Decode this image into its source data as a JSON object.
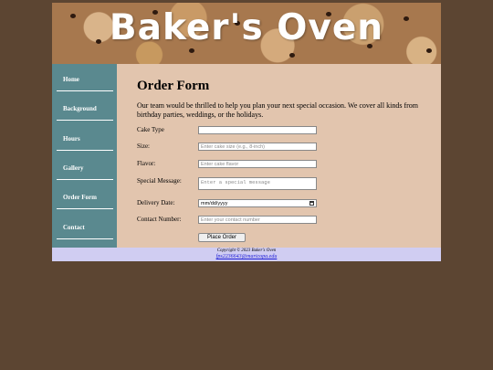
{
  "header": {
    "title": "Baker's Oven"
  },
  "sidebar": {
    "items": [
      {
        "label": "Home"
      },
      {
        "label": "Background"
      },
      {
        "label": "Hours"
      },
      {
        "label": "Gallery"
      },
      {
        "label": "Order Form"
      },
      {
        "label": "Contact"
      }
    ]
  },
  "main": {
    "title": "Order Form",
    "intro": "Our team would be thrilled to help you plan your next special occasion. We cover all kinds from birthday parties, weddings, or the holidays.",
    "form": {
      "cake_type": {
        "label": "Cake Type",
        "value": ""
      },
      "size": {
        "label": "Size:",
        "placeholder": "Enter cake size (e.g., 8-inch)"
      },
      "flavor": {
        "label": "Flavor:",
        "placeholder": "Enter cake flavor"
      },
      "message": {
        "label": "Special Message:",
        "placeholder": "Enter a special message"
      },
      "date": {
        "label": "Delivery Date:",
        "value": "mm/dd/yyyy"
      },
      "contact": {
        "label": "Contact Number:",
        "placeholder": "Enter your contact number"
      },
      "submit_label": "Place Order"
    }
  },
  "footer": {
    "copyright": "Copyright © 2023 Baker's Oven",
    "email": "fps2236643@maricopa.edu"
  },
  "colors": {
    "page_bg": "#5c4532",
    "content_bg": "#e2c5ae",
    "sidebar_bg": "#5a898f",
    "footer_bg": "#d0cdf2",
    "link": "#1a1ad6"
  }
}
